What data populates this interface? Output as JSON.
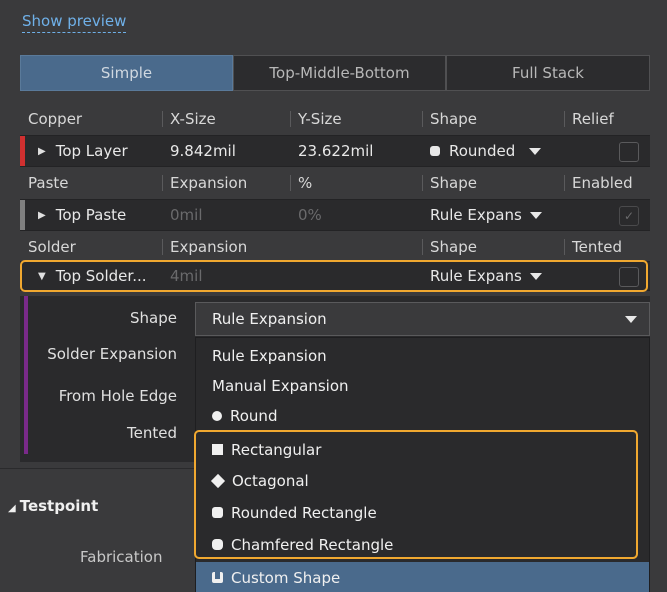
{
  "show_preview": "Show preview",
  "mode_tabs": [
    "Simple",
    "Top-Middle-Bottom",
    "Full Stack"
  ],
  "copper": {
    "headers": [
      "Copper",
      "X-Size",
      "Y-Size",
      "Shape",
      "Relief"
    ],
    "row": {
      "layer": "Top Layer",
      "x": "9.842mil",
      "y": "23.622mil",
      "shape": "Rounded"
    },
    "layer_color": "#d03030"
  },
  "paste": {
    "headers": [
      "Paste",
      "Expansion",
      "%",
      "Shape",
      "Enabled"
    ],
    "row": {
      "layer": "Top Paste",
      "expansion": "0mil",
      "percent": "0%",
      "shape": "Rule Expans"
    },
    "layer_color": "#808080"
  },
  "solder": {
    "headers": [
      "Solder",
      "Expansion",
      "Shape",
      "Tented"
    ],
    "row": {
      "layer": "Top Solder...",
      "expansion": "4mil",
      "shape": "Rule Expans"
    },
    "layer_color": "#7a2a8a"
  },
  "sub_labels": {
    "shape": "Shape",
    "solder_expansion": "Solder Expansion",
    "from_hole_edge": "From Hole Edge",
    "tented": "Tented"
  },
  "shape_select_value": "Rule Expansion",
  "dropdown_options": [
    {
      "label": "Rule Expansion",
      "icon": "none"
    },
    {
      "label": "Manual Expansion",
      "icon": "none"
    },
    {
      "label": "Round",
      "icon": "circle-icon"
    },
    {
      "label": "Rectangular",
      "icon": "square-icon"
    },
    {
      "label": "Octagonal",
      "icon": "diamond-icon"
    },
    {
      "label": "Rounded Rectangle",
      "icon": "rounded-square-icon"
    },
    {
      "label": "Chamfered Rectangle",
      "icon": "chamfered-square-icon"
    },
    {
      "label": "Custom Shape",
      "icon": "custom-shape-icon"
    }
  ],
  "testpoint_section": "Testpoint",
  "fabrication_label": "Fabrication",
  "colors": {
    "accent_highlight": "#f0a830",
    "selected": "#4a6a8c",
    "link": "#6fb0e8"
  }
}
